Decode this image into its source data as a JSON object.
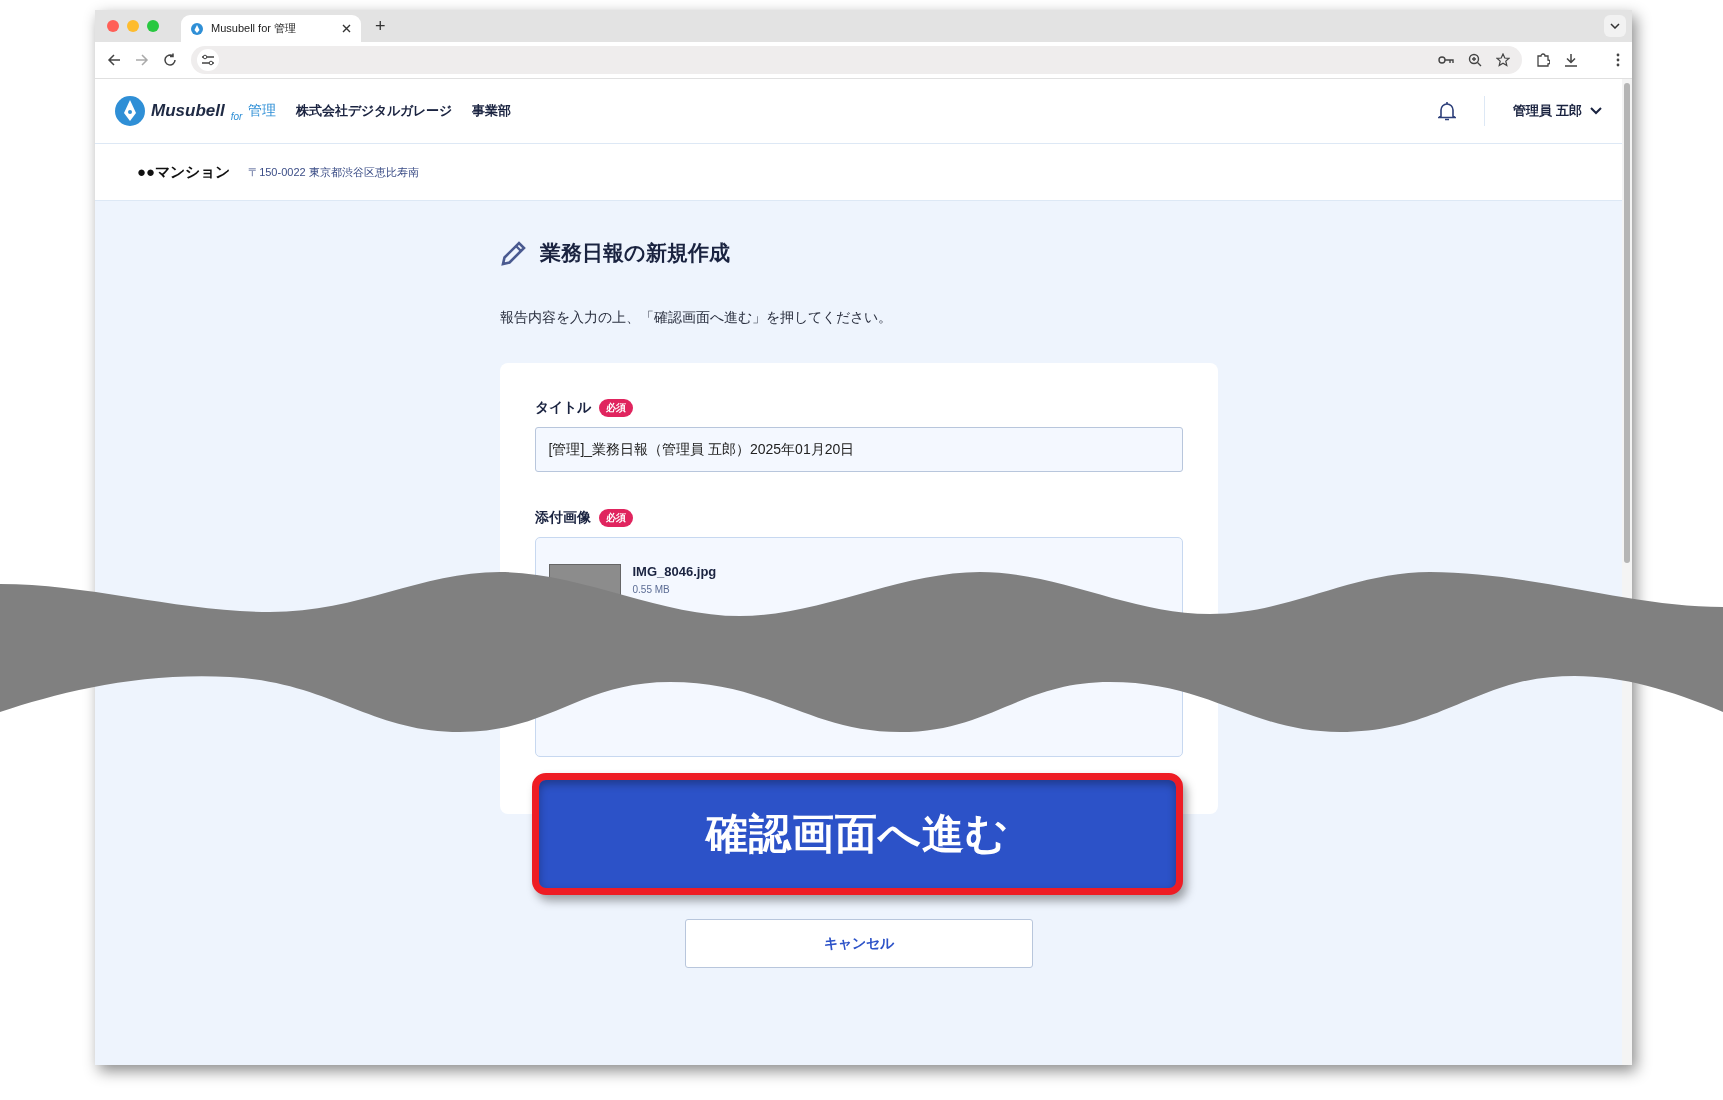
{
  "browser": {
    "tab": {
      "title": "Musubell for 管理"
    },
    "new_tab": "+"
  },
  "header": {
    "logo": {
      "name": "Musubell",
      "for": "for",
      "suffix": "管理"
    },
    "company": "株式会社デジタルガレージ",
    "department": "事業部",
    "user": "管理員 五郎"
  },
  "property": {
    "name": "●●マンション",
    "address": "〒150-0022 東京都渋谷区恵比寿南"
  },
  "page": {
    "title": "業務日報の新規作成",
    "instruction": "報告内容を入力の上、「確認画面へ進む」を押してください。"
  },
  "form": {
    "fields": [
      {
        "kind": "text",
        "label": "タイトル",
        "badge": "必須",
        "value": "[管理]_業務日報（管理員 五郎）2025年01月20日"
      },
      {
        "kind": "file",
        "label": "添付画像",
        "badge": "必須",
        "files": [
          {
            "name": "IMG_8046.jpg",
            "size": "0.55 MB"
          }
        ]
      }
    ]
  },
  "callout_button": {
    "label": "確認画面へ進む"
  },
  "cancel_button": {
    "label": "キャンセル"
  }
}
